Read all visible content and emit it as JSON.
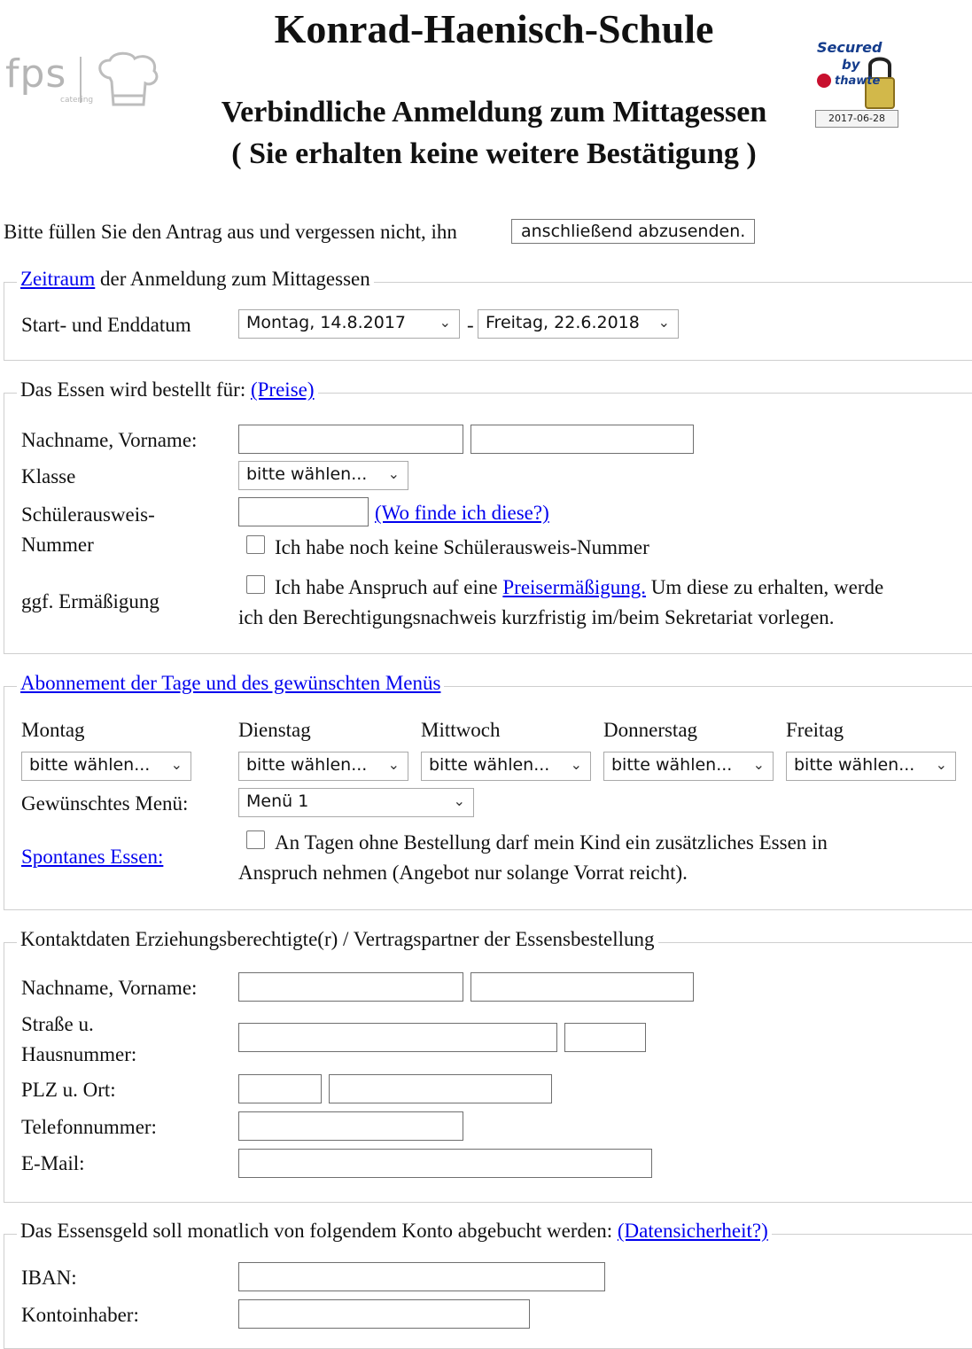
{
  "header": {
    "title": "Konrad-Haenisch-Schule",
    "subtitle": "Verbindliche Anmeldung zum Mittagessen",
    "note": "( Sie erhalten keine weitere Bestätigung )",
    "logo_main": "fps",
    "logo_small": "catering",
    "badge": {
      "line1": "Secured",
      "line2": "by",
      "brand": "thawte",
      "date": "2017-06-28"
    }
  },
  "intro": {
    "text": "Bitte füllen Sie den Antrag aus und vergessen nicht, ihn",
    "submit_label": "anschließend abzusenden."
  },
  "period": {
    "legend_link": "Zeitraum",
    "legend_rest": " der Anmeldung zum Mittagessen",
    "label": "Start- und Enddatum",
    "start": "Montag, 14.8.2017",
    "separator": "-",
    "end": "Freitag, 22.6.2018"
  },
  "order_for": {
    "legend": "Das Essen wird bestellt für: ",
    "legend_link": "(Preise)",
    "name_label": "Nachname, Vorname:",
    "class_label": "Klasse",
    "class_value": "bitte wählen...",
    "id_label": "Schülerausweis-",
    "id_label2": "Nummer",
    "id_help_link": "(Wo finde ich diese?)",
    "no_id_text": "Ich habe noch keine Schülerausweis-Nummer",
    "discount_label": "ggf. Ermäßigung",
    "discount_text_a": "Ich habe Anspruch auf eine ",
    "discount_link": "Preisermäßigung.",
    "discount_text_b": " Um diese zu erhalten, werde",
    "discount_text_c": "ich den Berechtigungsnachweis kurzfristig im/beim Sekretariat vorlegen."
  },
  "subscription": {
    "legend_link": "Abonnement der Tage und des gewünschten Menüs",
    "days": [
      {
        "label": "Montag",
        "value": "bitte wählen..."
      },
      {
        "label": "Dienstag",
        "value": "bitte wählen..."
      },
      {
        "label": "Mittwoch",
        "value": "bitte wählen..."
      },
      {
        "label": "Donnerstag",
        "value": "bitte wählen..."
      },
      {
        "label": "Freitag",
        "value": "bitte wählen..."
      }
    ],
    "menu_label": "Gewünschtes Menü:",
    "menu_value": "Menü 1",
    "spontaneous_link": "Spontanes Essen:",
    "spontaneous_text_a": "An Tagen ohne Bestellung darf mein Kind ein zusätzliches Essen in",
    "spontaneous_text_b": "Anspruch nehmen (Angebot nur solange Vorrat reicht)."
  },
  "contact": {
    "legend": "Kontaktdaten Erziehungsberechtigte(r) / Vertragspartner der Essensbestellung",
    "name_label": "Nachname, Vorname:",
    "street_label": "Straße u.",
    "street_label2": "Hausnummer:",
    "zip_label": "PLZ u. Ort:",
    "phone_label": "Telefonnummer:",
    "email_label": "E-Mail:"
  },
  "payment": {
    "legend": "Das Essensgeld soll monatlich von folgendem Konto abgebucht werden: ",
    "legend_link": "(Datensicherheit?)",
    "iban_label": "IBAN:",
    "holder_label": "Kontoinhaber:"
  }
}
